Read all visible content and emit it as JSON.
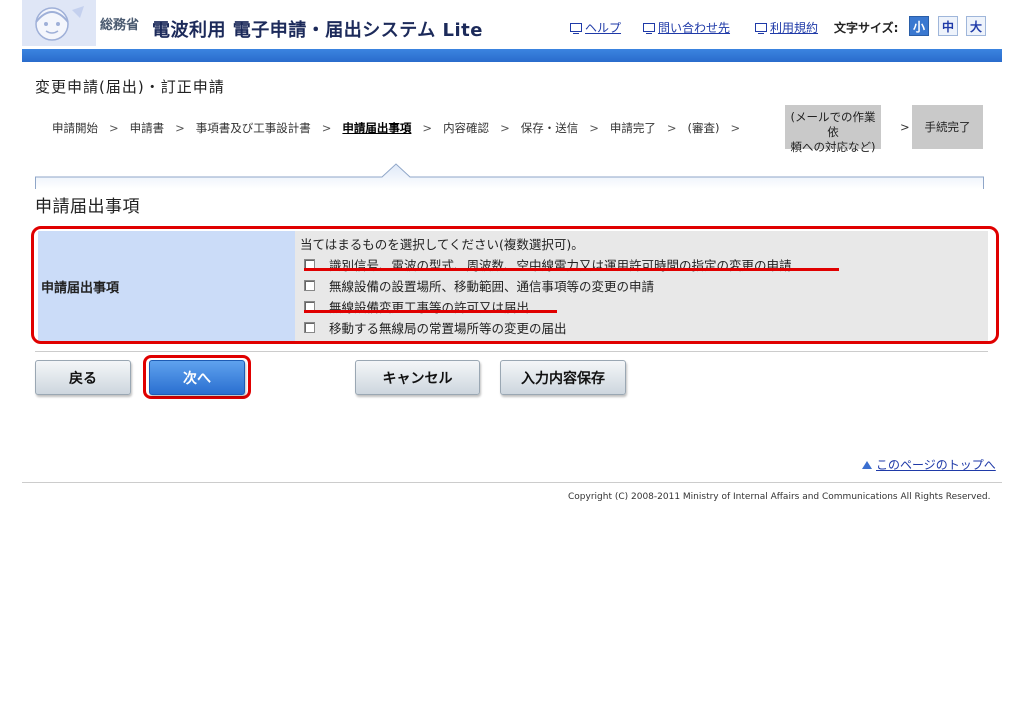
{
  "header": {
    "ministry": "総務省",
    "system_title": "電波利用 電子申請・届出システム Lite",
    "links": {
      "help": "ヘルプ",
      "contact": "問い合わせ先",
      "terms": "利用規約"
    },
    "font_size_label": "文字サイズ:",
    "font_sizes": {
      "small": "小",
      "medium": "中",
      "large": "大"
    },
    "selected_font_size": "小"
  },
  "page_title": "変更申請(届出)・訂正申請",
  "steps": {
    "items": [
      "申請開始",
      "申請書",
      "事項書及び工事設計書",
      "申請届出事項",
      "内容確認",
      "保存・送信",
      "申請完了",
      "(審査)"
    ],
    "current": "申請届出事項",
    "separator": ">",
    "mail_step_line1": "(メールでの作業依",
    "mail_step_line2": "頼への対応など)",
    "final_step": "手続完了"
  },
  "section_title": "申請届出事項",
  "form": {
    "label": "申請届出事項",
    "instruction": "当てはまるものを選択してください(複数選択可)。",
    "options": [
      {
        "label": "識別信号、電波の型式、周波数、空中線電力又は運用許可時間の指定の変更の申請",
        "checked": false,
        "highlighted": true
      },
      {
        "label": "無線設備の設置場所、移動範囲、通信事項等の変更の申請",
        "checked": false,
        "highlighted": false
      },
      {
        "label": "無線設備変更工事等の許可又は届出",
        "checked": false,
        "highlighted": true
      },
      {
        "label": "移動する無線局の常置場所等の変更の届出",
        "checked": false,
        "highlighted": false
      }
    ]
  },
  "buttons": {
    "back": "戻る",
    "next": "次へ",
    "cancel": "キャンセル",
    "save": "入力内容保存"
  },
  "to_top": "このページのトップへ",
  "copyright": "Copyright (C) 2008-2011 Ministry of Internal Affairs and Communications All Rights Reserved.",
  "colors": {
    "accent_blue": "#2a6ccc",
    "highlight_red": "#e00000",
    "label_cell": "#cbdcf8",
    "option_cell": "#e8e8e8"
  }
}
